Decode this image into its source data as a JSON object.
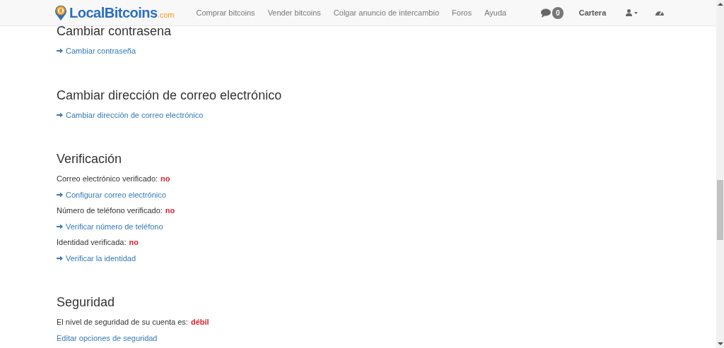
{
  "navbar": {
    "logo": {
      "name": "LocalBitcoins",
      "suffix": ".com"
    },
    "links": [
      "Comprar bitcoins",
      "Vender bitcoins",
      "Colgar anuncio de intercambio",
      "Foros",
      "Ayuda"
    ],
    "messages_count": "0",
    "wallet": "Cartera"
  },
  "sections": [
    {
      "title": "Cambiar contrasena",
      "lines": [
        {
          "kind": "arrow_link",
          "text": "Cambiar contraseña"
        }
      ]
    },
    {
      "title": "Cambiar dirección de correo electrónico",
      "lines": [
        {
          "kind": "arrow_link",
          "text": "Cambiar dirección de correo electrónico"
        }
      ]
    },
    {
      "title": "Verificación",
      "lines": [
        {
          "kind": "status",
          "label": "Correo electrónico verificado:",
          "value": "no"
        },
        {
          "kind": "arrow_link",
          "text": "Configurar correo electrónico"
        },
        {
          "kind": "status",
          "label": "Número de teléfono verificado:",
          "value": "no"
        },
        {
          "kind": "arrow_link",
          "text": "Verificar número de teléfono"
        },
        {
          "kind": "status",
          "label": "Identidad verificada:",
          "value": "no"
        },
        {
          "kind": "arrow_link",
          "text": "Verificar la identidad"
        }
      ]
    },
    {
      "title": "Seguridad",
      "lines": [
        {
          "kind": "status",
          "label": "El nivel de seguridad de su cuenta es:",
          "value": "débil"
        },
        {
          "kind": "link",
          "text": "Editar opciones de seguridad"
        }
      ]
    }
  ]
}
